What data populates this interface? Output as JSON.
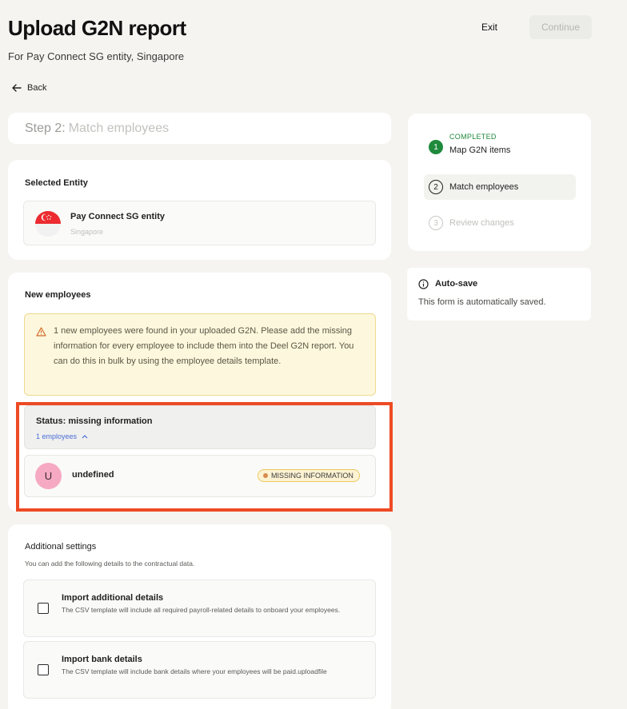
{
  "header": {
    "title": "Upload G2N report",
    "subtitle": "For Pay Connect SG entity, Singapore",
    "exit_label": "Exit",
    "continue_label": "Continue"
  },
  "back_label": "Back",
  "step": {
    "number": "Step 2:",
    "name": "Match employees"
  },
  "entity_section": {
    "title": "Selected Entity",
    "entity_name": "Pay Connect SG entity",
    "country": "Singapore"
  },
  "new_employees": {
    "title": "New employees",
    "alert_text": "1 new employees were found in your uploaded G2N. Please add the missing information for every employee to include them into the Deel G2N report. You can do this in bulk by using the employee details template.",
    "status_title": "Status: missing information",
    "status_count": "1 employees",
    "employees": [
      {
        "initial": "U",
        "name": "undefined",
        "badge": "MISSING INFORMATION"
      }
    ]
  },
  "additional_settings": {
    "title": "Additional settings",
    "description": "You can add the following details to the contractual data.",
    "options": [
      {
        "title": "Import additional details",
        "description": "The CSV template will include all required payroll-related details to onboard your employees."
      },
      {
        "title": "Import bank details",
        "description": "The CSV template will include bank details where your employees will be paid.uploadfile"
      }
    ]
  },
  "stepper": {
    "steps": [
      {
        "number": "1",
        "label": "Map G2N items",
        "tag": "COMPLETED"
      },
      {
        "number": "2",
        "label": "Match employees"
      },
      {
        "number": "3",
        "label": "Review changes"
      }
    ]
  },
  "autosave": {
    "title": "Auto-save",
    "description": "This form is automatically saved."
  },
  "colors": {
    "highlight": "#ee4a24",
    "completed": "#1f8a3c",
    "link": "#4a6ed8",
    "alert_bg": "#fdf8dd"
  },
  "icons": [
    "arrow-left-icon",
    "warning-triangle-icon",
    "chevron-up-icon",
    "info-icon",
    "singapore-flag-icon"
  ]
}
